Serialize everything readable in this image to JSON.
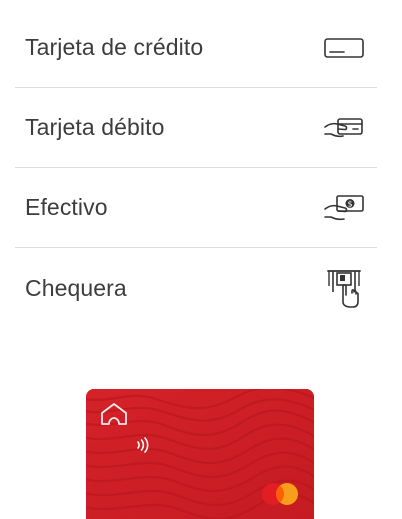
{
  "payment_methods": [
    {
      "label": "Tarjeta de crédito",
      "icon": "credit-card-icon"
    },
    {
      "label": "Tarjeta débito",
      "icon": "debit-card-hand-icon"
    },
    {
      "label": "Efectivo",
      "icon": "cash-hand-icon"
    },
    {
      "label": "Chequera",
      "icon": "atm-withdraw-icon"
    }
  ],
  "card": {
    "color": "#cf1f26",
    "brand_icon": "mastercard-logo-icon",
    "logo_icon": "bank-home-logo-icon",
    "contactless_icon": "contactless-icon"
  },
  "colors": {
    "text": "#3d3d3d",
    "divider": "#dddddd",
    "icon_stroke": "#333333"
  }
}
